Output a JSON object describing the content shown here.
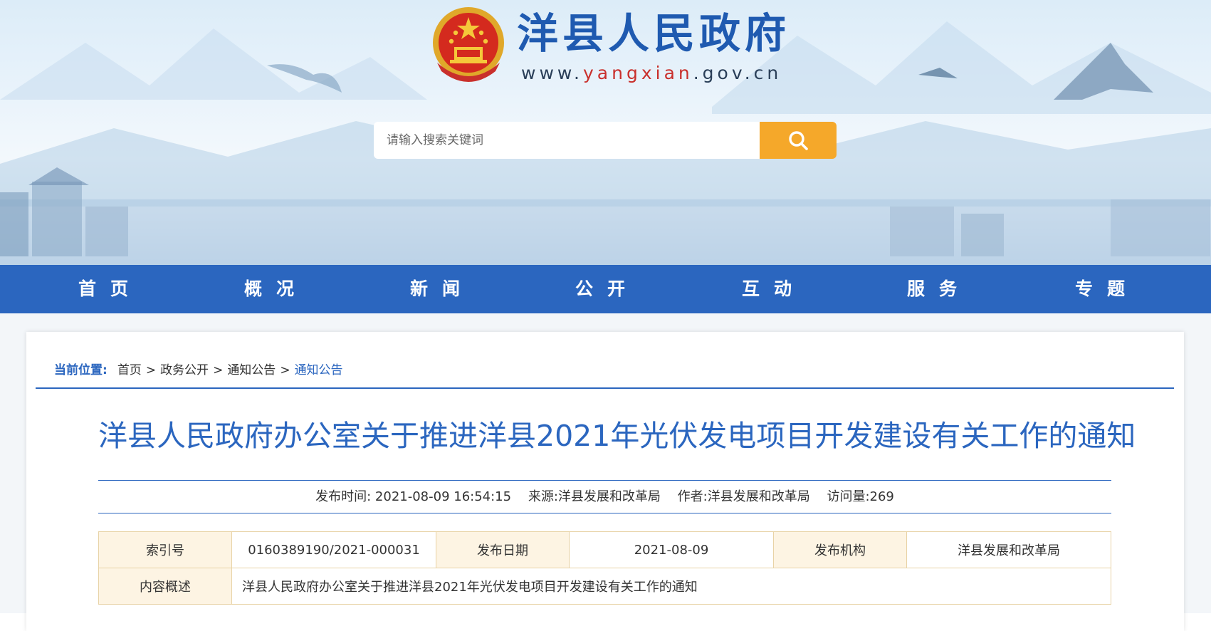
{
  "header": {
    "site_title": "洋县人民政府",
    "site_url_prefix": "www.",
    "site_url_accent": "yangxian",
    "site_url_suffix": ".gov.cn",
    "emblem_icon": "national-emblem-icon"
  },
  "search": {
    "placeholder": "请输入搜索关键词",
    "button_icon": "search-icon",
    "button_color": "#f5a82a"
  },
  "nav": {
    "background": "#2b66bf",
    "items": [
      "首页",
      "概况",
      "新闻",
      "公开",
      "互动",
      "服务",
      "专题"
    ]
  },
  "breadcrumb": {
    "label": "当前位置:",
    "items": [
      "首页",
      "政务公开",
      "通知公告",
      "通知公告"
    ],
    "separator": ">"
  },
  "article": {
    "title": "洋县人民政府办公室关于推进洋县2021年光伏发电项目开发建设有关工作的通知",
    "meta": {
      "publish_time": "发布时间:  2021-08-09 16:54:15",
      "source": "来源:洋县发展和改革局",
      "author": "作者:洋县发展和改革局",
      "visits": "访问量:269"
    }
  },
  "info_table": {
    "index_label": "索引号",
    "index_value": "0160389190/2021-000031",
    "date_label": "发布日期",
    "date_value": "2021-08-09",
    "org_label": "发布机构",
    "org_value": "洋县发展和改革局",
    "summary_label": "内容概述",
    "summary_value": "洋县人民政府办公室关于推进洋县2021年光伏发电项目开发建设有关工作的通知"
  }
}
